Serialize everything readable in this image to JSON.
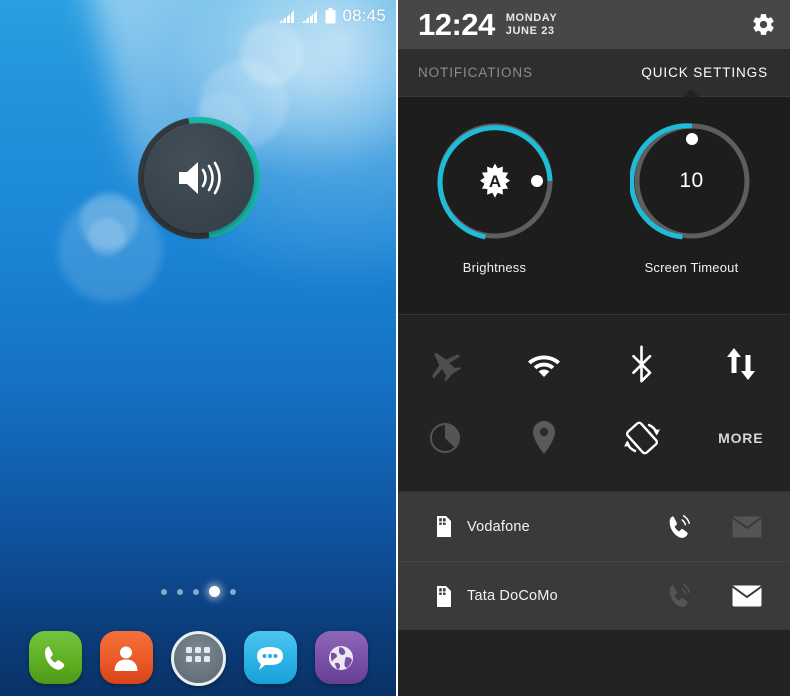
{
  "left_phone": {
    "status_bar": {
      "time": "08:45",
      "icons": [
        "signal-bars-icon",
        "signal-bars-icon",
        "battery-icon"
      ]
    },
    "volume_widget": {
      "name": "volume-widget",
      "icon": "speaker-volume-icon",
      "level_percent": 55,
      "ring_color": "#19b9a8",
      "track_color": "#333b40"
    },
    "page_indicator": {
      "total": 5,
      "active_index": 3
    },
    "dock": [
      {
        "label": "Phone",
        "icon": "phone-handset-icon",
        "color": "#5fb022"
      },
      {
        "label": "Contacts",
        "icon": "person-icon",
        "color": "#ea5a27"
      },
      {
        "label": "Apps",
        "icon": "app-drawer-grid-icon",
        "color": "#69757e"
      },
      {
        "label": "Messaging",
        "icon": "speech-bubble-icon",
        "color": "#2bb2e6"
      },
      {
        "label": "Browser",
        "icon": "globe-icon",
        "color": "#7a4fa7"
      }
    ]
  },
  "right_phone": {
    "header": {
      "time": "12:24",
      "day": "MONDAY",
      "date": "JUNE 23",
      "settings_icon": "gear-icon"
    },
    "tabs": [
      {
        "label": "NOTIFICATIONS",
        "active": false
      },
      {
        "label": "QUICK SETTINGS",
        "active": true
      }
    ],
    "sliders": [
      {
        "label": "Brightness",
        "icon": "auto-brightness-icon",
        "center_text": "",
        "value_percent": 75,
        "ring_color": "#1fbcd8",
        "track_color": "#5e5e5e",
        "handle_color": "#ffffff"
      },
      {
        "label": "Screen Timeout",
        "icon": "",
        "center_text": "10",
        "value_percent": 50,
        "ring_color": "#1fbcd8",
        "track_color": "#5e5e5e",
        "handle_color": "#ffffff"
      }
    ],
    "toggles": [
      {
        "label": "Airplane mode",
        "icon": "airplane-icon",
        "active": false
      },
      {
        "label": "Wi-Fi",
        "icon": "wifi-icon",
        "active": true
      },
      {
        "label": "Bluetooth",
        "icon": "bluetooth-icon",
        "active": true
      },
      {
        "label": "Mobile data",
        "icon": "data-transfer-icon",
        "active": true
      },
      {
        "label": "Data usage",
        "icon": "pie-circle-icon",
        "active": false
      },
      {
        "label": "Location",
        "icon": "location-pin-icon",
        "active": false
      },
      {
        "label": "Auto rotate",
        "icon": "auto-rotate-icon",
        "active": true
      },
      {
        "label": "MORE",
        "icon": "more-label",
        "active": true
      }
    ],
    "sim_cards": [
      {
        "name": "Vodafone",
        "icon": "sim-card-icon",
        "call_icon": "phone-call-icon",
        "call_active": true,
        "sms_icon": "envelope-icon",
        "sms_active": false
      },
      {
        "name": "Tata DoCoMo",
        "icon": "sim-card-icon",
        "call_icon": "phone-call-icon",
        "call_active": false,
        "sms_icon": "envelope-icon",
        "sms_active": true
      }
    ]
  }
}
